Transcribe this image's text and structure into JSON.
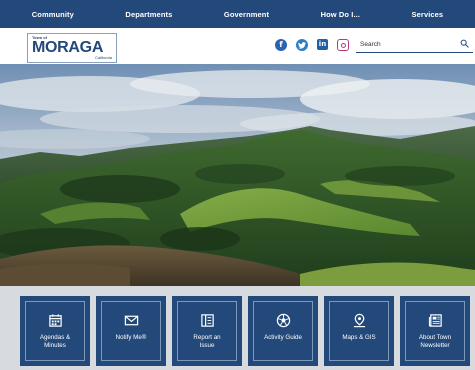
{
  "nav": {
    "items": [
      "Community",
      "Departments",
      "Government",
      "How Do I...",
      "Services"
    ]
  },
  "logo": {
    "top_text": "Town of",
    "name": "MORAGA",
    "bottom_text": "California"
  },
  "social": [
    "facebook-icon",
    "twitter-icon",
    "linkedin-icon",
    "instagram-icon"
  ],
  "search": {
    "placeholder": "Search"
  },
  "quick_links": [
    {
      "label": "Agendas &\nMinutes",
      "icon": "calendar-icon"
    },
    {
      "label": "Notify Me®",
      "icon": "envelope-icon"
    },
    {
      "label": "Report an\nIssue",
      "icon": "book-icon"
    },
    {
      "label": "Activity Guide",
      "icon": "ball-icon"
    },
    {
      "label": "Maps & GIS",
      "icon": "map-pin-icon"
    },
    {
      "label": "About Town\nNewsletter",
      "icon": "newspaper-icon"
    }
  ],
  "colors": {
    "primary": "#22497a",
    "quicklinks_bg": "#d7dbe0"
  }
}
